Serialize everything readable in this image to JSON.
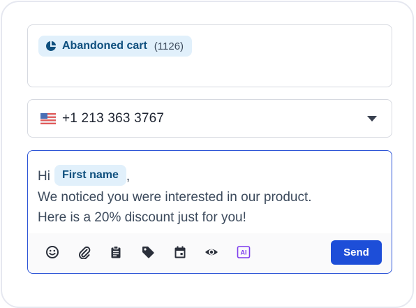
{
  "segment": {
    "name": "Abandoned cart",
    "count": "(1126)",
    "icon": "pie-chart-icon",
    "chip_color": "#e1f0fb",
    "text_color": "#0e4f7e"
  },
  "phone": {
    "country_icon": "us-flag-icon",
    "number": "+1 213 363 3767",
    "dropdown_icon": "caret-down-icon"
  },
  "message": {
    "greeting": "Hi",
    "variable": "First name",
    "after_variable": ",",
    "line2": "We noticed you were interested in our product.",
    "line3": "Here is a 20% discount just for you!"
  },
  "toolbar": {
    "tools": [
      {
        "icon": "emoji-icon"
      },
      {
        "icon": "attachment-icon"
      },
      {
        "icon": "clipboard-icon"
      },
      {
        "icon": "tag-icon"
      },
      {
        "icon": "calendar-icon"
      },
      {
        "icon": "preview-eye-icon"
      },
      {
        "icon": "ai-icon",
        "label": "AI"
      }
    ],
    "send_label": "Send"
  },
  "colors": {
    "accent": "#1d4ed8",
    "focus_border": "#2d55d6",
    "ai_purple": "#7c3aed"
  }
}
